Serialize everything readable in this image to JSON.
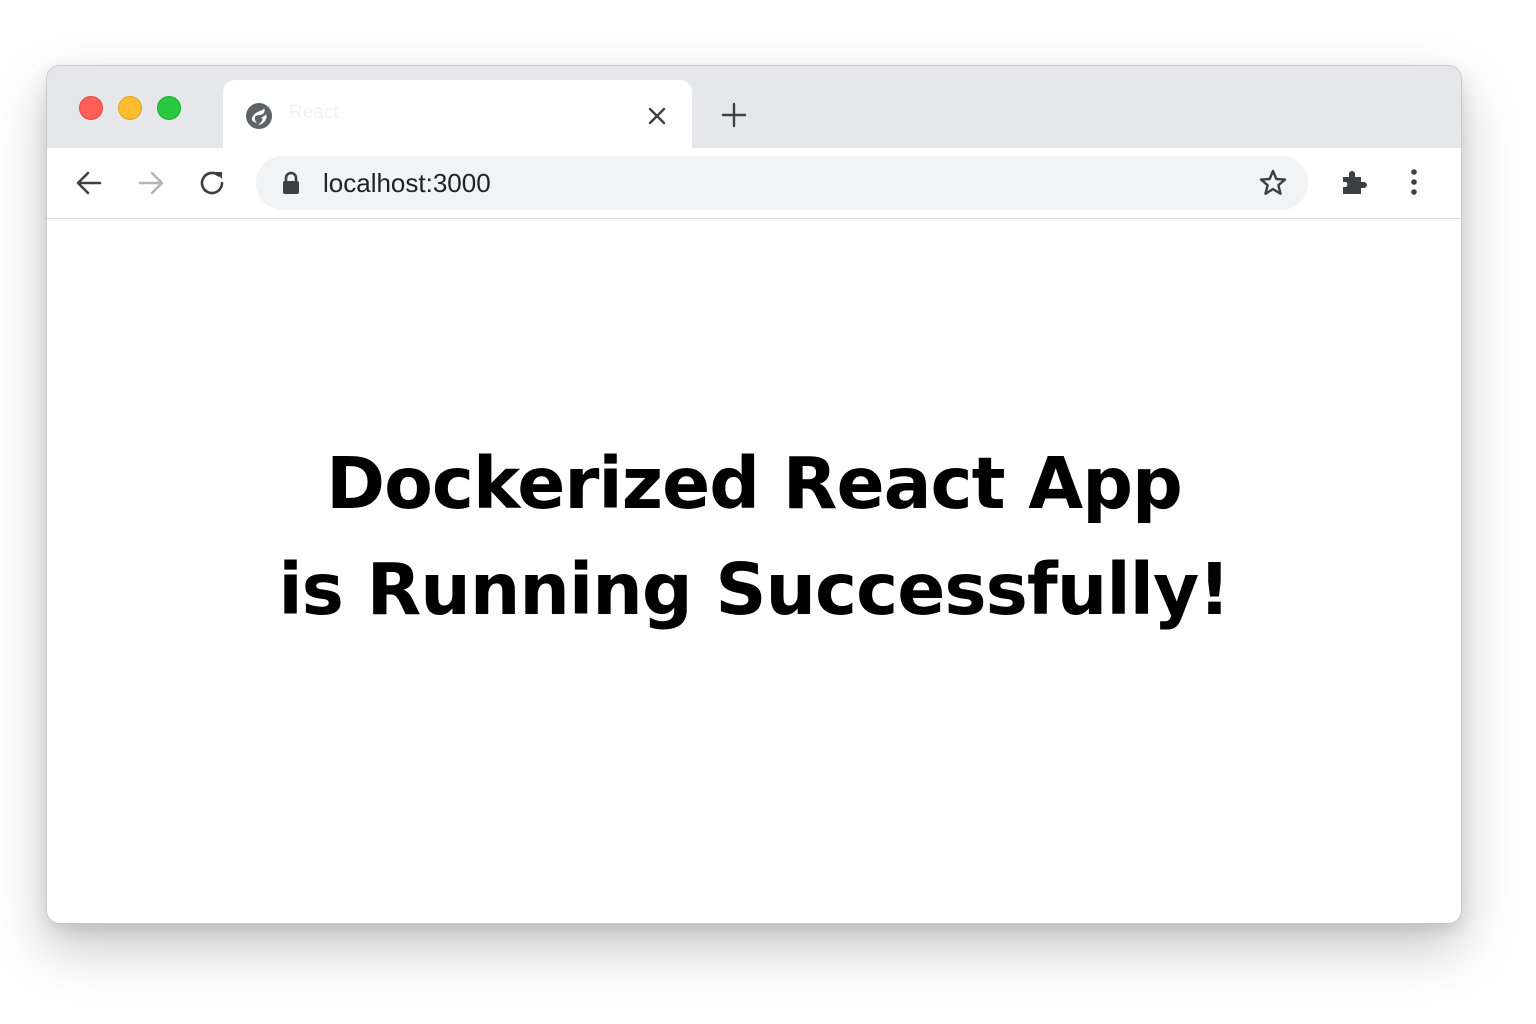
{
  "browser": {
    "tab": {
      "title": "React",
      "favicon": "globe-icon",
      "close_icon": "close-icon"
    },
    "new_tab_icon": "plus-icon",
    "toolbar": {
      "back_icon": "arrow-left-icon",
      "forward_icon": "arrow-right-icon",
      "reload_icon": "reload-icon",
      "address": "localhost:3000",
      "secure_icon": "lock-icon",
      "bookmark_icon": "star-icon",
      "extensions_icon": "puzzle-icon",
      "menu_icon": "kebab-menu-icon"
    },
    "window_controls": {
      "close_color": "#ff5f57",
      "minimize_color": "#febc2e",
      "maximize_color": "#28c840"
    }
  },
  "page": {
    "headline_line1": "Dockerized React App",
    "headline_line2": "is Running Successfully!"
  }
}
